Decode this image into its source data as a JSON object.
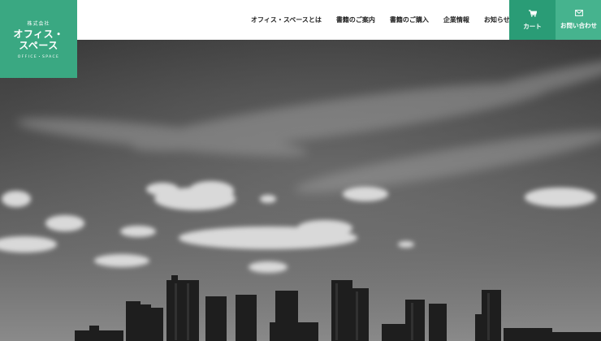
{
  "brand": {
    "company_type": "株式会社",
    "name_line1": "オフィス・",
    "name_line2": "スペース",
    "name_en": "OFFICE・SPACE",
    "color": "#3aa882"
  },
  "nav": {
    "items": [
      {
        "label": "オフィス・スペースとは"
      },
      {
        "label": "書籍のご案内"
      },
      {
        "label": "書籍のご購入"
      },
      {
        "label": "企業情報"
      },
      {
        "label": "お知らせ"
      }
    ]
  },
  "cta": {
    "cart_label": "カート",
    "cart_icon": "cart-icon",
    "contact_label": "お問い合わせ",
    "contact_icon": "mail-icon",
    "cart_color": "#2a9c76",
    "contact_color": "#46b38e"
  },
  "hero": {
    "image": "grayscale city skyline under cloudy sky"
  }
}
